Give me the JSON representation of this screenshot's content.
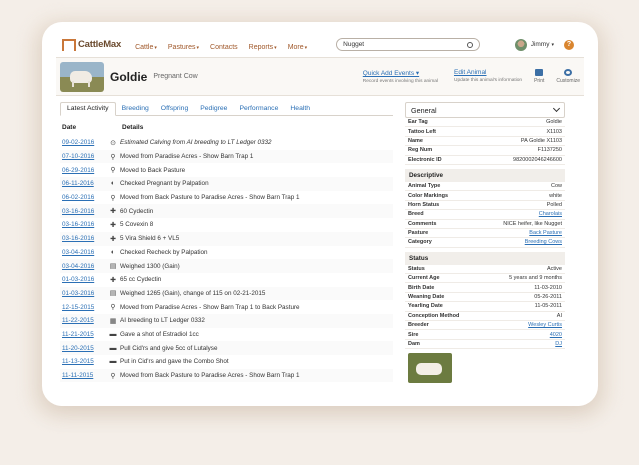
{
  "app": {
    "logo_text": "CattleMax"
  },
  "nav": {
    "items": [
      {
        "label": "Cattle",
        "caret": true
      },
      {
        "label": "Pastures",
        "caret": true
      },
      {
        "label": "Contacts",
        "caret": false
      },
      {
        "label": "Reports",
        "caret": true
      },
      {
        "label": "More",
        "caret": true
      }
    ],
    "caret_glyph": "▾"
  },
  "search": {
    "value": "Nugget"
  },
  "user": {
    "name": "Jimmy",
    "caret": "▾",
    "help": "?"
  },
  "animal": {
    "name": "Goldie",
    "status": "Pregnant Cow",
    "quick_add": {
      "label": "Quick Add Events ▾",
      "sub": "Record events involving this animal"
    },
    "edit": {
      "label": "Edit Animal",
      "sub": "Update this animal's information"
    },
    "print_label": "Print",
    "customize_label": "Customize"
  },
  "tabs": [
    "Latest Activity",
    "Breeding",
    "Offspring",
    "Pedigree",
    "Performance",
    "Health"
  ],
  "activity": {
    "col_date": "Date",
    "col_details": "Details",
    "rows": [
      {
        "date": "09-02-2016",
        "icon": "⊙",
        "icon_name": "clock-icon",
        "text": "Estimated Calving from AI breeding to LT Ledger 0332",
        "italic": true
      },
      {
        "date": "07-10-2016",
        "icon": "⚲",
        "icon_name": "location-pin-icon",
        "text": "Moved from Paradise Acres - Show Barn Trap 1",
        "italic": false
      },
      {
        "date": "06-29-2016",
        "icon": "⚲",
        "icon_name": "location-pin-icon",
        "text": "Moved to Back Pasture",
        "italic": false
      },
      {
        "date": "06-11-2016",
        "icon": "◐",
        "icon_name": "pregnancy-check-icon",
        "text": "Checked Pregnant by Palpation",
        "italic": false
      },
      {
        "date": "06-02-2016",
        "icon": "⚲",
        "icon_name": "location-pin-icon",
        "text": "Moved from Back Pasture to Paradise Acres - Show Barn Trap 1",
        "italic": false
      },
      {
        "date": "03-16-2016",
        "icon": "✚",
        "icon_name": "health-cross-icon",
        "text": "60 Cydectin",
        "italic": false
      },
      {
        "date": "03-16-2016",
        "icon": "✚",
        "icon_name": "health-cross-icon",
        "text": "5 Covexin 8",
        "italic": false
      },
      {
        "date": "03-16-2016",
        "icon": "✚",
        "icon_name": "health-cross-icon",
        "text": "5 Vira Shield 6 + VL5",
        "italic": false
      },
      {
        "date": "03-04-2016",
        "icon": "◐",
        "icon_name": "pregnancy-check-icon",
        "text": "Checked Recheck by Palpation",
        "italic": false
      },
      {
        "date": "03-04-2016",
        "icon": "▤",
        "icon_name": "scale-icon",
        "text": "Weighed 1300 (Gain)",
        "italic": false
      },
      {
        "date": "01-03-2016",
        "icon": "✚",
        "icon_name": "health-cross-icon",
        "text": "65 cc Cydectin",
        "italic": false
      },
      {
        "date": "01-03-2016",
        "icon": "▤",
        "icon_name": "scale-icon",
        "text": "Weighed 1265 (Gain), change of 115 on 02-21-2015",
        "italic": false
      },
      {
        "date": "12-15-2015",
        "icon": "⚲",
        "icon_name": "location-pin-icon",
        "text": "Moved from Paradise Acres - Show Barn Trap 1 to Back Pasture",
        "italic": false
      },
      {
        "date": "11-22-2015",
        "icon": "▦",
        "icon_name": "breeding-icon",
        "text": "AI breeding to LT Ledger 0332",
        "italic": false
      },
      {
        "date": "11-21-2015",
        "icon": "▬",
        "icon_name": "note-icon",
        "text": "Gave a shot of Estradiol 1cc",
        "italic": false
      },
      {
        "date": "11-20-2015",
        "icon": "▬",
        "icon_name": "note-icon",
        "text": "Pull Cid'rs and give 5cc of Lutalyse",
        "italic": false
      },
      {
        "date": "11-13-2015",
        "icon": "▬",
        "icon_name": "note-icon",
        "text": "Put in Cid'rs and gave the Combo Shot",
        "italic": false
      },
      {
        "date": "11-11-2015",
        "icon": "⚲",
        "icon_name": "location-pin-icon",
        "text": "Moved from Back Pasture to Paradise Acres - Show Barn Trap 1",
        "italic": false
      }
    ]
  },
  "panel": {
    "title": "General",
    "general": [
      {
        "k": "Ear Tag",
        "v": "Goldie",
        "link": false
      },
      {
        "k": "Tattoo Left",
        "v": "X1103",
        "link": false
      },
      {
        "k": "Name",
        "v": "PA Goldie X1103",
        "link": false
      },
      {
        "k": "Reg Num",
        "v": "F1137250",
        "link": false
      },
      {
        "k": "Electronic ID",
        "v": "9820002046246600",
        "link": false
      }
    ],
    "descriptive_title": "Descriptive",
    "descriptive": [
      {
        "k": "Animal Type",
        "v": "Cow",
        "link": false
      },
      {
        "k": "Color Markings",
        "v": "white",
        "link": false
      },
      {
        "k": "Horn Status",
        "v": "Polled",
        "link": false
      },
      {
        "k": "Breed",
        "v": "Charolais",
        "link": true
      },
      {
        "k": "Comments",
        "v": "NICE heifer, like Nugget",
        "link": false
      },
      {
        "k": "Pasture",
        "v": "Back Pasture",
        "link": true
      },
      {
        "k": "Category",
        "v": "Breeding Cows",
        "link": true
      }
    ],
    "status_title": "Status",
    "status": [
      {
        "k": "Status",
        "v": "Active",
        "link": false
      },
      {
        "k": "Current Age",
        "v": "5 years and 9 months",
        "link": false
      },
      {
        "k": "Birth Date",
        "v": "11-03-2010",
        "link": false
      },
      {
        "k": "Weaning Date",
        "v": "05-26-2011",
        "link": false
      },
      {
        "k": "Yearling Date",
        "v": "11-05-2011",
        "link": false
      },
      {
        "k": "Conception Method",
        "v": "AI",
        "link": false
      },
      {
        "k": "Breeder",
        "v": "Wesley Curtis",
        "link": true
      },
      {
        "k": "Sire",
        "v": "4020",
        "link": true
      },
      {
        "k": "Dam",
        "v": "DJ",
        "link": true
      }
    ]
  }
}
